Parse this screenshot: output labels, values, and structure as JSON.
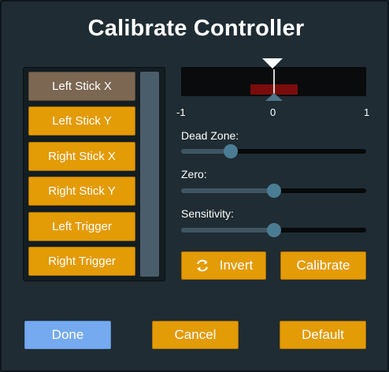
{
  "dialog": {
    "title": "Calibrate Controller"
  },
  "axes": {
    "selected_index": 0,
    "items": [
      {
        "label": "Left Stick X"
      },
      {
        "label": "Left Stick Y"
      },
      {
        "label": "Right Stick X"
      },
      {
        "label": "Right Stick Y"
      },
      {
        "label": "Left Trigger"
      },
      {
        "label": "Right Trigger"
      }
    ]
  },
  "meter": {
    "min_label": "-1",
    "center_label": "0",
    "max_label": "1"
  },
  "sliders": {
    "dead_zone": {
      "label": "Dead Zone:",
      "value": 0.27
    },
    "zero": {
      "label": "Zero:",
      "value": 0.5
    },
    "sensitivity": {
      "label": "Sensitivity:",
      "value": 0.5
    }
  },
  "actions": {
    "invert_label": "Invert",
    "invert_icon": "refresh-icon",
    "calibrate_label": "Calibrate"
  },
  "footer": {
    "done_label": "Done",
    "cancel_label": "Cancel",
    "default_label": "Default"
  },
  "colors": {
    "background": "#1f2c33",
    "button": "#e39b06",
    "button_selected": "#7b6752",
    "done_button": "#75aaf0",
    "meter_bar": "#7a0c0c",
    "slider_thumb": "#4a7d94"
  }
}
